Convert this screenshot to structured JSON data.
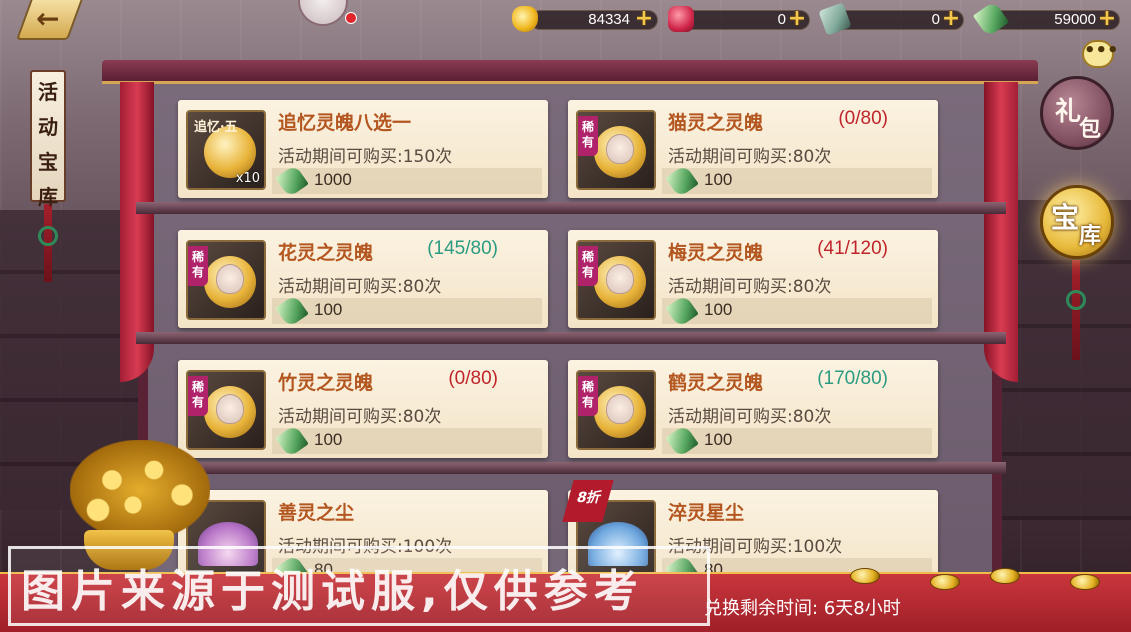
{
  "resources": [
    {
      "icon": "gold-ingot-icon",
      "value": "84334"
    },
    {
      "icon": "red-envelope-icon",
      "value": "0"
    },
    {
      "icon": "scroll-icon",
      "value": "0"
    },
    {
      "icon": "jade-icon",
      "value": "59000"
    }
  ],
  "plus_symbol": "+",
  "side_banner": {
    "chars": [
      "活",
      "动",
      "宝",
      "库"
    ]
  },
  "right_menu": {
    "gift": [
      "礼",
      "包"
    ],
    "vault": [
      "宝",
      "库"
    ],
    "chat_symbol": "•••"
  },
  "items": [
    {
      "name": "追忆灵魄八选一",
      "count": "",
      "limit": "活动期间可购买:150次",
      "price": "1000",
      "badge": "追忆·五",
      "qty": "x10",
      "count_color": ""
    },
    {
      "name": "猫灵之灵魄",
      "count": "(0/80)",
      "limit": "活动期间可购买:80次",
      "price": "100",
      "badge": "稀有",
      "qty": "",
      "count_color": "red"
    },
    {
      "name": "花灵之灵魄",
      "count": "(145/80)",
      "limit": "活动期间可购买:80次",
      "price": "100",
      "badge": "稀有",
      "qty": "",
      "count_color": "teal"
    },
    {
      "name": "梅灵之灵魄",
      "count": "(41/120)",
      "limit": "活动期间可购买:80次",
      "price": "100",
      "badge": "稀有",
      "qty": "",
      "count_color": "red"
    },
    {
      "name": "竹灵之灵魄",
      "count": "(0/80)",
      "limit": "活动期间可购买:80次",
      "price": "100",
      "badge": "稀有",
      "qty": "",
      "count_color": "red"
    },
    {
      "name": "鹤灵之灵魄",
      "count": "(170/80)",
      "limit": "活动期间可购买:80次",
      "price": "100",
      "badge": "稀有",
      "qty": "",
      "count_color": "teal"
    },
    {
      "name": "善灵之尘",
      "count": "",
      "limit": "活动期间可购买:100次",
      "price": "80",
      "badge": "",
      "qty": "",
      "count_color": ""
    },
    {
      "name": "淬灵星尘",
      "count": "",
      "limit": "活动期间可购买:100次",
      "price": "80",
      "badge": "8折",
      "qty": "",
      "count_color": ""
    }
  ],
  "footer": {
    "timer_label": "兑换剩余时间:",
    "timer_value": "6天8小时"
  },
  "watermark": "图片来源于测试服,仅供参考"
}
